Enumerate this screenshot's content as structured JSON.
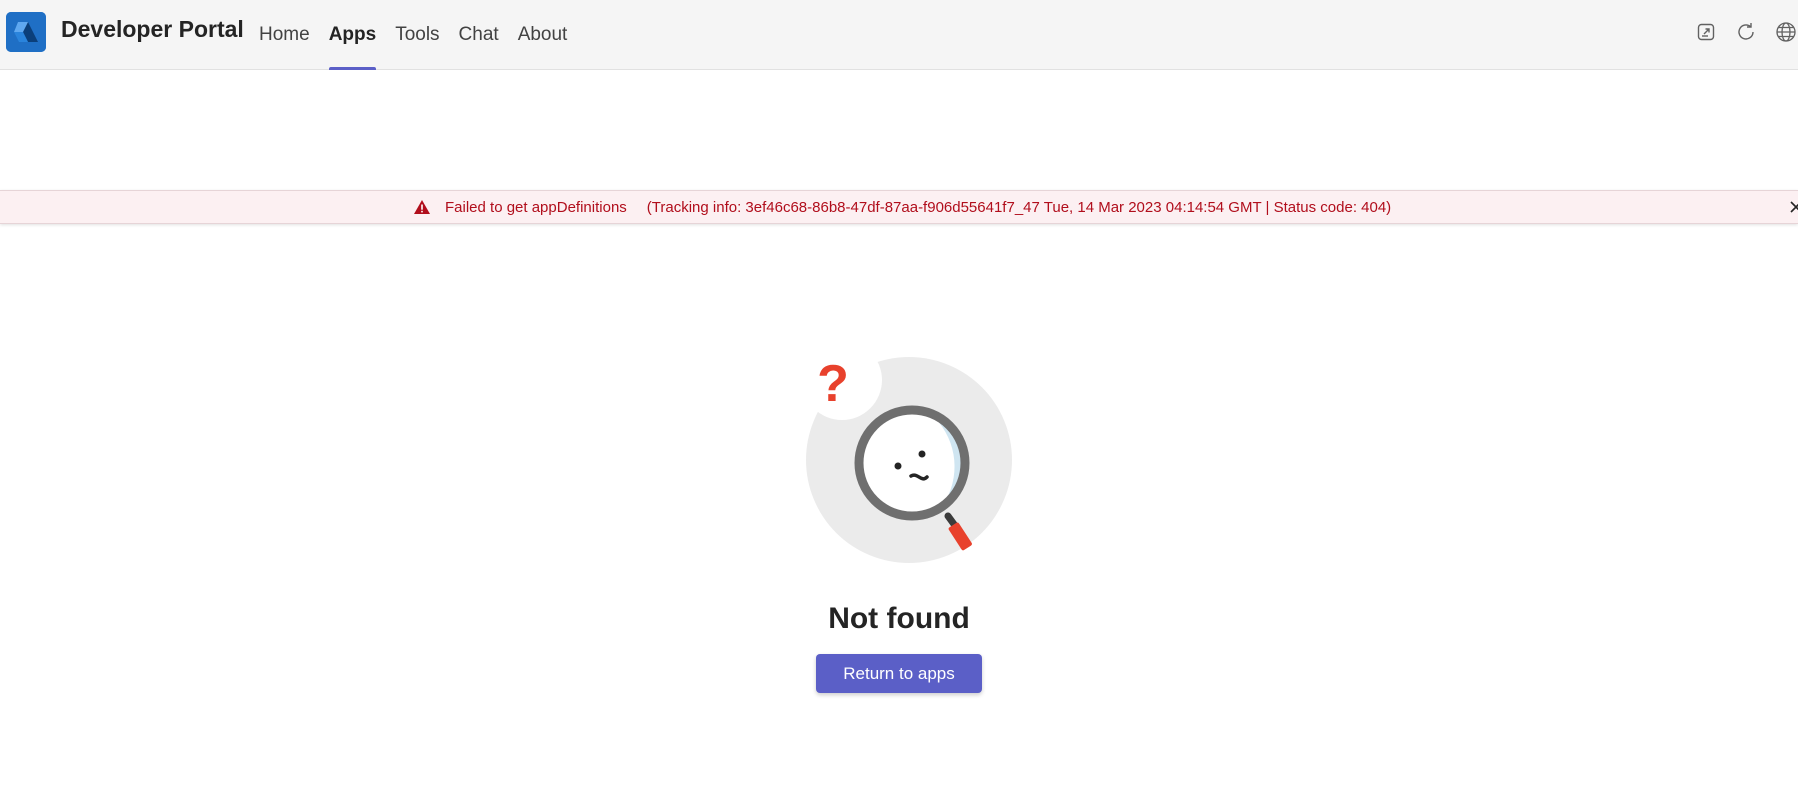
{
  "header": {
    "title": "Developer Portal",
    "logo_icon": "developer-portal-logo-icon",
    "nav": [
      {
        "label": "Home",
        "active": false
      },
      {
        "label": "Apps",
        "active": true
      },
      {
        "label": "Tools",
        "active": false
      },
      {
        "label": "Chat",
        "active": false
      },
      {
        "label": "About",
        "active": false
      }
    ],
    "actions": [
      {
        "icon": "open-in-new-window-icon"
      },
      {
        "icon": "refresh-icon"
      },
      {
        "icon": "globe-icon"
      }
    ]
  },
  "banner": {
    "message": "Failed to get appDefinitions",
    "tracking": "(Tracking info: 3ef46c68-86b8-47df-87aa-f906d55641f7_47 Tue, 14 Mar 2023 04:14:54 GMT | Status code: 404)",
    "icon": "warning-icon",
    "close_icon": "close-icon",
    "color": "#b10e1c",
    "background": "#fcf0f2"
  },
  "empty_state": {
    "illustration": "magnifying-glass-question-illustration",
    "title": "Not found",
    "button_label": "Return to apps"
  },
  "colors": {
    "accent": "#5b5fc7",
    "error": "#b10e1c"
  }
}
